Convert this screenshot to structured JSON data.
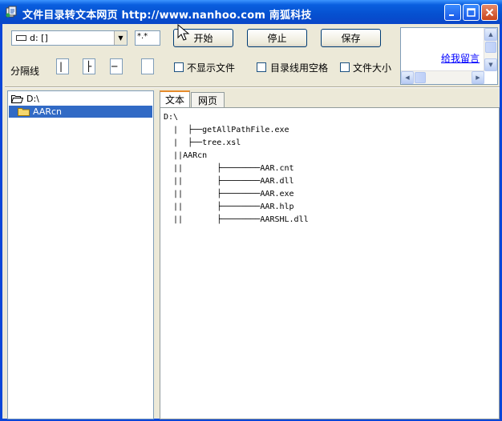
{
  "window": {
    "title": "文件目录转文本网页 http://www.nanhoo.com 南狐科技",
    "controls": [
      "minimize",
      "maximize",
      "close"
    ]
  },
  "toolbar": {
    "drive_combo": {
      "value": "d: []"
    },
    "filter": {
      "value": "*.*"
    },
    "start_label": "开始",
    "stop_label": "停止",
    "save_label": "保存",
    "separator_label": "分隔线",
    "separator_values": [
      "|",
      "├",
      "─",
      ""
    ],
    "checkboxes": [
      {
        "label": "不显示文件",
        "checked": false
      },
      {
        "label": "目录线用空格",
        "checked": false
      },
      {
        "label": "文件大小",
        "checked": false
      }
    ]
  },
  "link_panel": {
    "link_text": "给我留言"
  },
  "tree": {
    "root": "D:\\",
    "items": [
      {
        "label": "AARcn",
        "selected": true
      }
    ]
  },
  "tabs": [
    {
      "label": "文本",
      "active": true
    },
    {
      "label": "网页",
      "active": false
    }
  ],
  "output_lines": [
    "D:\\",
    "  |  ├──getAllPathFile.exe",
    "  |  ├──tree.xsl",
    "  ||AARcn",
    "  ||       ├────────AAR.cnt",
    "  ||       ├────────AAR.dll",
    "  ||       ├────────AAR.exe",
    "  ||       ├────────AAR.hlp",
    "  ||       ├────────AARSHL.dll"
  ],
  "colors": {
    "titlebar": "#0a5fdf",
    "selection": "#316ac5",
    "link": "#0000ff",
    "tab_accent": "#e68b2c"
  }
}
